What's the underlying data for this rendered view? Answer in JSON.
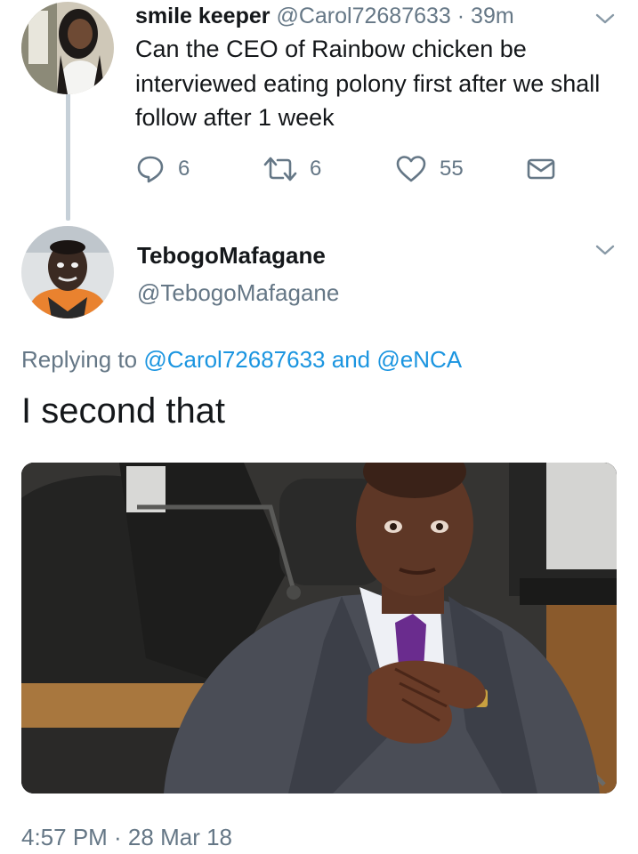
{
  "parent_tweet": {
    "display_name": "smile keeper",
    "handle": "@Carol72687633",
    "separator": "·",
    "age": "39m",
    "text": "Can the CEO of Rainbow chicken be interviewed eating polony first after we shall follow after 1 week",
    "replies": "6",
    "retweets": "6",
    "likes": "55"
  },
  "reply_tweet": {
    "display_name": "TebogoMafagane",
    "handle": "@TebogoMafagane",
    "replying_prefix": "Replying to",
    "replying_user_1": "@Carol72687633",
    "replying_and": "and",
    "replying_user_2": "@eNCA",
    "text": "I second that",
    "timestamp": "4:57 PM · 28 Mar 18"
  },
  "colors": {
    "text": "#14171a",
    "secondary": "#657786",
    "link": "#1b95e0",
    "thread_line": "#c6d0d8"
  },
  "icons": [
    "chevron-down-icon",
    "reply-icon",
    "retweet-icon",
    "heart-icon",
    "direct-message-icon"
  ]
}
